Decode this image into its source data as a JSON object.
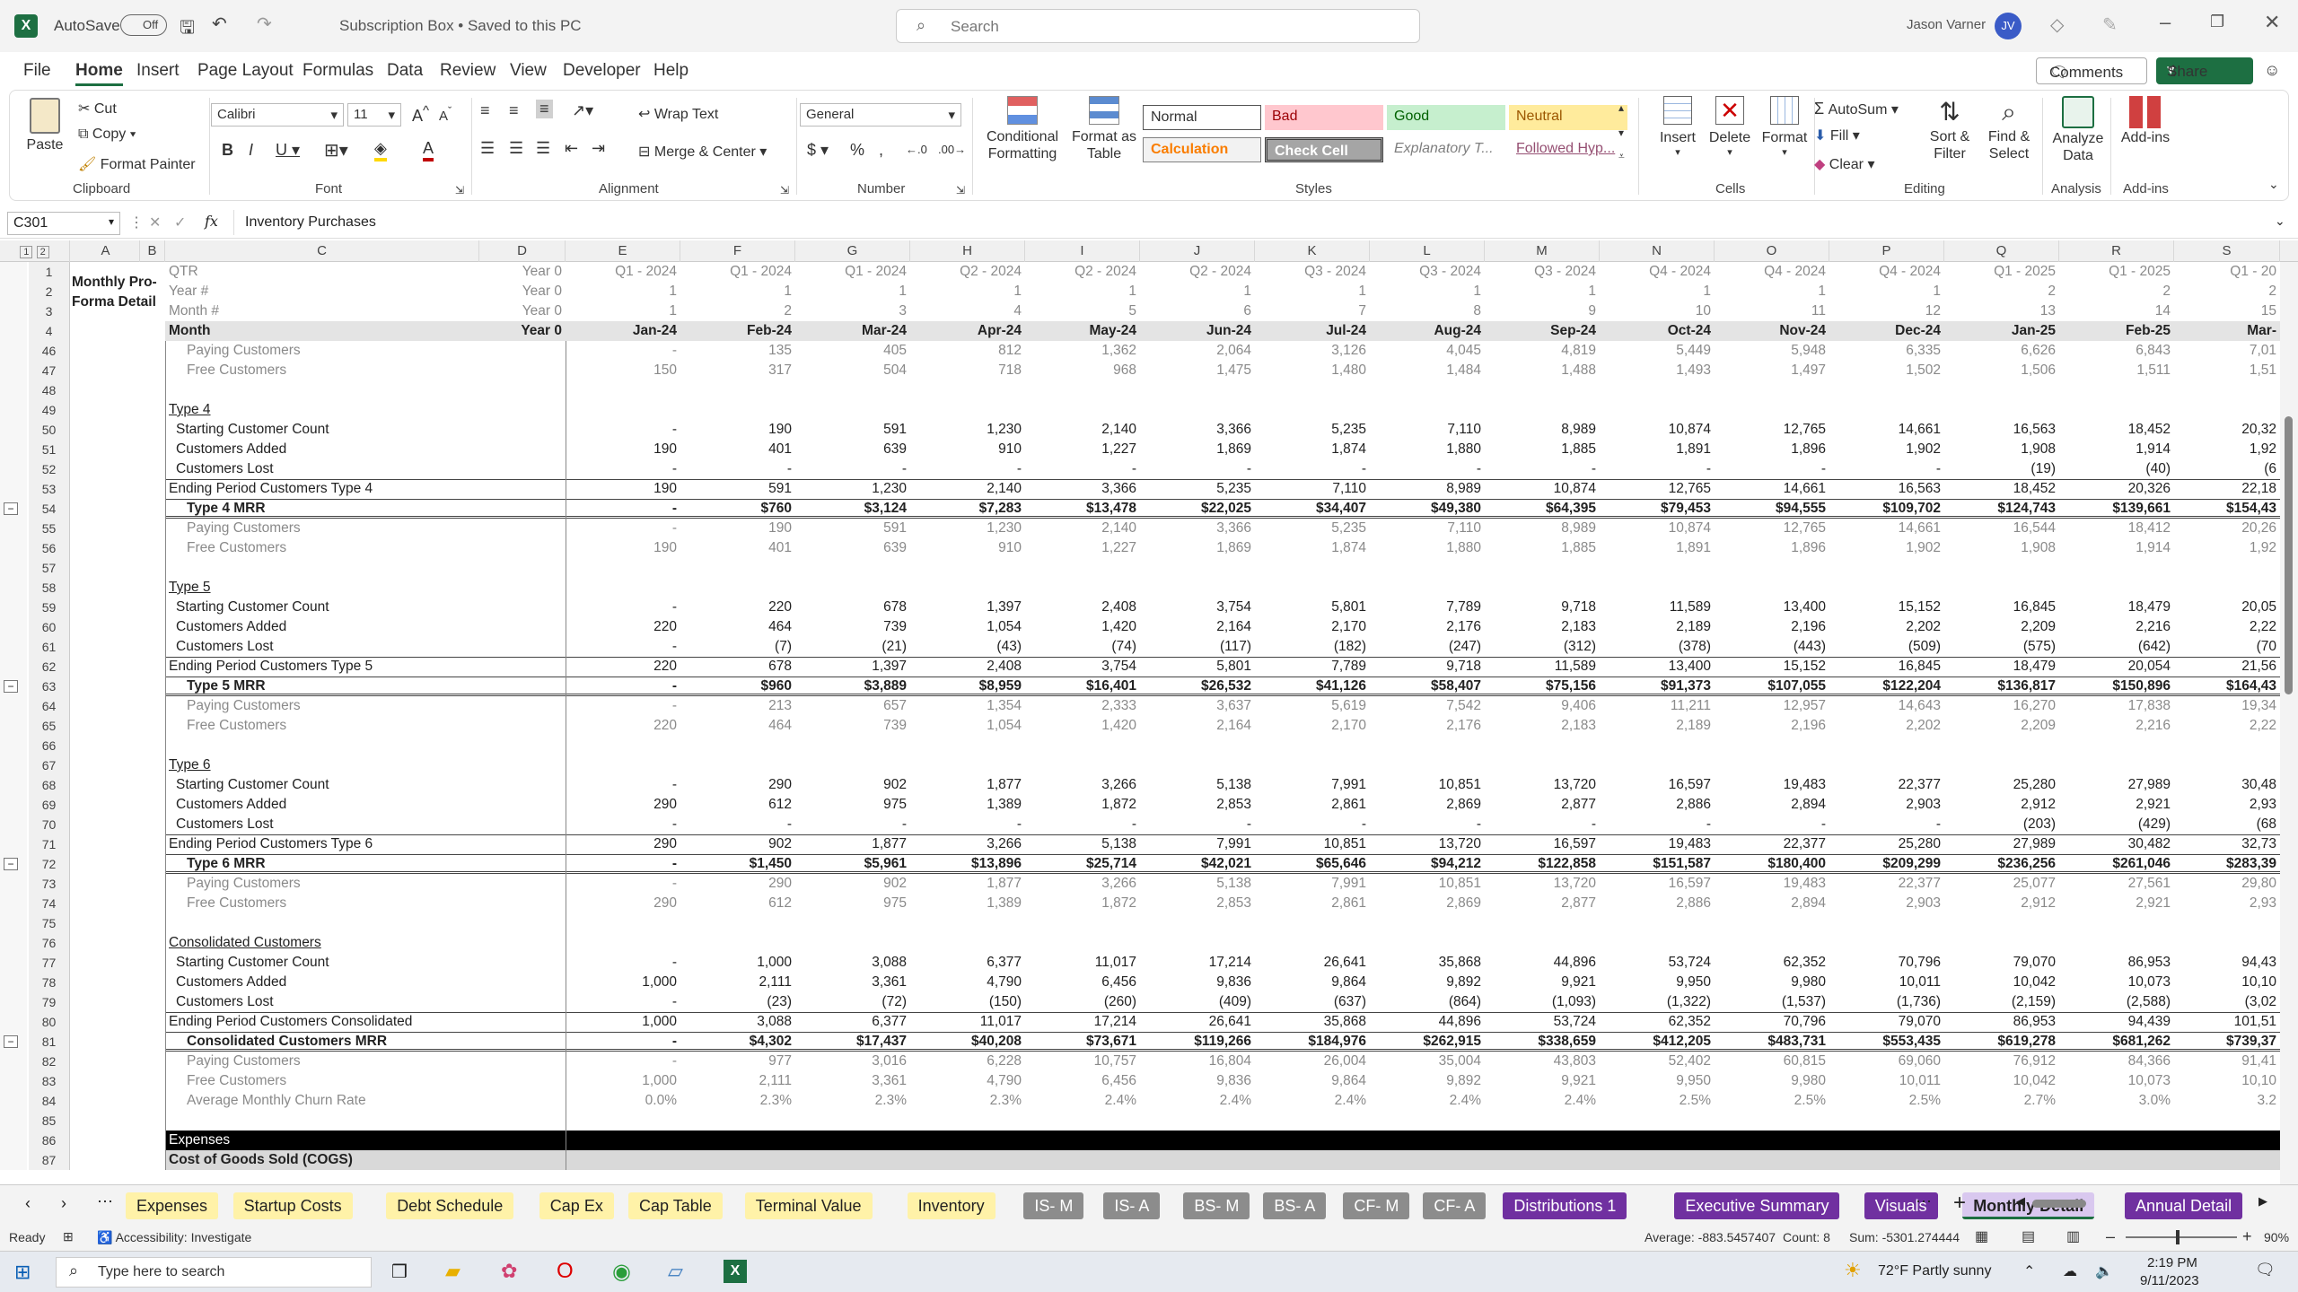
{
  "title": {
    "autosave": "AutoSave",
    "autosave_state": "Off",
    "doc": "Subscription Box • Saved to this PC",
    "search": "Search",
    "user": "Jason Varner",
    "initials": "JV"
  },
  "menu": [
    "File",
    "Home",
    "Insert",
    "Page Layout",
    "Formulas",
    "Data",
    "Review",
    "View",
    "Developer",
    "Help"
  ],
  "comments": "Comments",
  "share": "Share",
  "ribbon": {
    "paste": "Paste",
    "cut": "Cut",
    "copy": "Copy",
    "format_painter": "Format Painter",
    "clipboard": "Clipboard",
    "font_name": "Calibri",
    "font_size": "11",
    "font": "Font",
    "wrap": "Wrap Text",
    "merge": "Merge & Center",
    "alignment": "Alignment",
    "numfmt": "General",
    "number": "Number",
    "cond": "Conditional Formatting",
    "fmt_table": "Format as Table",
    "styles": [
      "Normal",
      "Bad",
      "Good",
      "Neutral",
      "Calculation",
      "Check Cell",
      "Explanatory T...",
      "Followed Hyp..."
    ],
    "styles_label": "Styles",
    "insert": "Insert",
    "delete": "Delete",
    "format": "Format",
    "cells": "Cells",
    "autosum": "AutoSum",
    "fill": "Fill",
    "clear": "Clear",
    "sort": "Sort & Filter",
    "find": "Find & Select",
    "editing": "Editing",
    "analyze": "Analyze Data",
    "analysis": "Analysis",
    "addins": "Add-ins",
    "addins_label": "Add-ins"
  },
  "formula": {
    "namebox": "C301",
    "content": "Inventory Purchases"
  },
  "columns": [
    "A",
    "B",
    "C",
    "D",
    "E",
    "F",
    "G",
    "H",
    "I",
    "J",
    "K",
    "L",
    "M",
    "N",
    "O",
    "P",
    "Q",
    "R",
    "S"
  ],
  "header_rows": [
    {
      "n": "1",
      "label": "QTR",
      "d": "Year 0",
      "vals": [
        "Q1 - 2024",
        "Q1 - 2024",
        "Q1 - 2024",
        "Q2 - 2024",
        "Q2 - 2024",
        "Q2 - 2024",
        "Q3 - 2024",
        "Q3 - 2024",
        "Q3 - 2024",
        "Q4 - 2024",
        "Q4 - 2024",
        "Q4 - 2024",
        "Q1 - 2025",
        "Q1 - 2025",
        "Q1 - 20"
      ]
    },
    {
      "n": "2",
      "label": "Year #",
      "d": "Year 0",
      "vals": [
        "1",
        "1",
        "1",
        "1",
        "1",
        "1",
        "1",
        "1",
        "1",
        "1",
        "1",
        "1",
        "2",
        "2",
        "2"
      ]
    },
    {
      "n": "3",
      "label": "Month #",
      "d": "Year 0",
      "vals": [
        "1",
        "2",
        "3",
        "4",
        "5",
        "6",
        "7",
        "8",
        "9",
        "10",
        "11",
        "12",
        "13",
        "14",
        "15"
      ]
    },
    {
      "n": "4",
      "label": "Month",
      "d": "Year 0",
      "vals": [
        "Jan-24",
        "Feb-24",
        "Mar-24",
        "Apr-24",
        "May-24",
        "Jun-24",
        "Jul-24",
        "Aug-24",
        "Sep-24",
        "Oct-24",
        "Nov-24",
        "Dec-24",
        "Jan-25",
        "Feb-25",
        "Mar-"
      ]
    }
  ],
  "sheet_title": "Monthly Pro-Forma Detail",
  "rows": [
    {
      "n": "46",
      "label": "Paying Customers",
      "s": "grey",
      "vals": [
        "-",
        "135",
        "405",
        "812",
        "1,362",
        "2,064",
        "3,126",
        "4,045",
        "4,819",
        "5,449",
        "5,948",
        "6,335",
        "6,626",
        "6,843",
        "7,01"
      ]
    },
    {
      "n": "47",
      "label": "Free Customers",
      "s": "grey",
      "vals": [
        "150",
        "317",
        "504",
        "718",
        "968",
        "1,475",
        "1,480",
        "1,484",
        "1,488",
        "1,493",
        "1,497",
        "1,502",
        "1,506",
        "1,511",
        "1,51"
      ]
    },
    {
      "n": "48",
      "label": "",
      "vals": []
    },
    {
      "n": "49",
      "label": "Type 4",
      "s": "u",
      "vals": []
    },
    {
      "n": "50",
      "label": "Starting Customer Count",
      "vals": [
        "-",
        "190",
        "591",
        "1,230",
        "2,140",
        "3,366",
        "5,235",
        "7,110",
        "8,989",
        "10,874",
        "12,765",
        "14,661",
        "16,563",
        "18,452",
        "20,32"
      ]
    },
    {
      "n": "51",
      "label": "Customers Added",
      "vals": [
        "190",
        "401",
        "639",
        "910",
        "1,227",
        "1,869",
        "1,874",
        "1,880",
        "1,885",
        "1,891",
        "1,896",
        "1,902",
        "1,908",
        "1,914",
        "1,92"
      ]
    },
    {
      "n": "52",
      "label": "Customers Lost",
      "vals": [
        "-",
        "-",
        "-",
        "-",
        "-",
        "-",
        "-",
        "-",
        "-",
        "-",
        "-",
        "-",
        "(19)",
        "(40)",
        "(6"
      ]
    },
    {
      "n": "53",
      "label": "Ending Period Customers Type 4",
      "s": "end",
      "vals": [
        "190",
        "591",
        "1,230",
        "2,140",
        "3,366",
        "5,235",
        "7,110",
        "8,989",
        "10,874",
        "12,765",
        "14,661",
        "16,563",
        "18,452",
        "20,326",
        "22,18"
      ]
    },
    {
      "n": "54",
      "label": "Type 4 MRR",
      "s": "mrr",
      "vals": [
        "-",
        "$760",
        "$3,124",
        "$7,283",
        "$13,478",
        "$22,025",
        "$34,407",
        "$49,380",
        "$64,395",
        "$79,453",
        "$94,555",
        "$109,702",
        "$124,743",
        "$139,661",
        "$154,43"
      ]
    },
    {
      "n": "55",
      "label": "Paying Customers",
      "s": "grey",
      "vals": [
        "-",
        "190",
        "591",
        "1,230",
        "2,140",
        "3,366",
        "5,235",
        "7,110",
        "8,989",
        "10,874",
        "12,765",
        "14,661",
        "16,544",
        "18,412",
        "20,26"
      ]
    },
    {
      "n": "56",
      "label": "Free Customers",
      "s": "grey",
      "vals": [
        "190",
        "401",
        "639",
        "910",
        "1,227",
        "1,869",
        "1,874",
        "1,880",
        "1,885",
        "1,891",
        "1,896",
        "1,902",
        "1,908",
        "1,914",
        "1,92"
      ]
    },
    {
      "n": "57",
      "label": "",
      "vals": []
    },
    {
      "n": "58",
      "label": "Type 5",
      "s": "u",
      "vals": []
    },
    {
      "n": "59",
      "label": "Starting Customer Count",
      "vals": [
        "-",
        "220",
        "678",
        "1,397",
        "2,408",
        "3,754",
        "5,801",
        "7,789",
        "9,718",
        "11,589",
        "13,400",
        "15,152",
        "16,845",
        "18,479",
        "20,05"
      ]
    },
    {
      "n": "60",
      "label": "Customers Added",
      "vals": [
        "220",
        "464",
        "739",
        "1,054",
        "1,420",
        "2,164",
        "2,170",
        "2,176",
        "2,183",
        "2,189",
        "2,196",
        "2,202",
        "2,209",
        "2,216",
        "2,22"
      ]
    },
    {
      "n": "61",
      "label": "Customers Lost",
      "vals": [
        "-",
        "(7)",
        "(21)",
        "(43)",
        "(74)",
        "(117)",
        "(182)",
        "(247)",
        "(312)",
        "(378)",
        "(443)",
        "(509)",
        "(575)",
        "(642)",
        "(70"
      ]
    },
    {
      "n": "62",
      "label": "Ending Period Customers Type 5",
      "s": "end",
      "vals": [
        "220",
        "678",
        "1,397",
        "2,408",
        "3,754",
        "5,801",
        "7,789",
        "9,718",
        "11,589",
        "13,400",
        "15,152",
        "16,845",
        "18,479",
        "20,054",
        "21,56"
      ]
    },
    {
      "n": "63",
      "label": "Type 5 MRR",
      "s": "mrr",
      "vals": [
        "-",
        "$960",
        "$3,889",
        "$8,959",
        "$16,401",
        "$26,532",
        "$41,126",
        "$58,407",
        "$75,156",
        "$91,373",
        "$107,055",
        "$122,204",
        "$136,817",
        "$150,896",
        "$164,43"
      ]
    },
    {
      "n": "64",
      "label": "Paying Customers",
      "s": "grey",
      "vals": [
        "-",
        "213",
        "657",
        "1,354",
        "2,333",
        "3,637",
        "5,619",
        "7,542",
        "9,406",
        "11,211",
        "12,957",
        "14,643",
        "16,270",
        "17,838",
        "19,34"
      ]
    },
    {
      "n": "65",
      "label": "Free Customers",
      "s": "grey",
      "vals": [
        "220",
        "464",
        "739",
        "1,054",
        "1,420",
        "2,164",
        "2,170",
        "2,176",
        "2,183",
        "2,189",
        "2,196",
        "2,202",
        "2,209",
        "2,216",
        "2,22"
      ]
    },
    {
      "n": "66",
      "label": "",
      "vals": []
    },
    {
      "n": "67",
      "label": "Type 6",
      "s": "u",
      "vals": []
    },
    {
      "n": "68",
      "label": "Starting Customer Count",
      "vals": [
        "-",
        "290",
        "902",
        "1,877",
        "3,266",
        "5,138",
        "7,991",
        "10,851",
        "13,720",
        "16,597",
        "19,483",
        "22,377",
        "25,280",
        "27,989",
        "30,48"
      ]
    },
    {
      "n": "69",
      "label": "Customers Added",
      "vals": [
        "290",
        "612",
        "975",
        "1,389",
        "1,872",
        "2,853",
        "2,861",
        "2,869",
        "2,877",
        "2,886",
        "2,894",
        "2,903",
        "2,912",
        "2,921",
        "2,93"
      ]
    },
    {
      "n": "70",
      "label": "Customers Lost",
      "vals": [
        "-",
        "-",
        "-",
        "-",
        "-",
        "-",
        "-",
        "-",
        "-",
        "-",
        "-",
        "-",
        "(203)",
        "(429)",
        "(68"
      ]
    },
    {
      "n": "71",
      "label": "Ending Period Customers Type 6",
      "s": "end",
      "vals": [
        "290",
        "902",
        "1,877",
        "3,266",
        "5,138",
        "7,991",
        "10,851",
        "13,720",
        "16,597",
        "19,483",
        "22,377",
        "25,280",
        "27,989",
        "30,482",
        "32,73"
      ]
    },
    {
      "n": "72",
      "label": "Type 6 MRR",
      "s": "mrr",
      "vals": [
        "-",
        "$1,450",
        "$5,961",
        "$13,896",
        "$25,714",
        "$42,021",
        "$65,646",
        "$94,212",
        "$122,858",
        "$151,587",
        "$180,400",
        "$209,299",
        "$236,256",
        "$261,046",
        "$283,39"
      ]
    },
    {
      "n": "73",
      "label": "Paying Customers",
      "s": "grey",
      "vals": [
        "-",
        "290",
        "902",
        "1,877",
        "3,266",
        "5,138",
        "7,991",
        "10,851",
        "13,720",
        "16,597",
        "19,483",
        "22,377",
        "25,077",
        "27,561",
        "29,80"
      ]
    },
    {
      "n": "74",
      "label": "Free Customers",
      "s": "grey",
      "vals": [
        "290",
        "612",
        "975",
        "1,389",
        "1,872",
        "2,853",
        "2,861",
        "2,869",
        "2,877",
        "2,886",
        "2,894",
        "2,903",
        "2,912",
        "2,921",
        "2,93"
      ]
    },
    {
      "n": "75",
      "label": "",
      "vals": []
    },
    {
      "n": "76",
      "label": "Consolidated Customers",
      "s": "u",
      "vals": []
    },
    {
      "n": "77",
      "label": "Starting Customer Count",
      "vals": [
        "-",
        "1,000",
        "3,088",
        "6,377",
        "11,017",
        "17,214",
        "26,641",
        "35,868",
        "44,896",
        "53,724",
        "62,352",
        "70,796",
        "79,070",
        "86,953",
        "94,43"
      ]
    },
    {
      "n": "78",
      "label": "Customers Added",
      "vals": [
        "1,000",
        "2,111",
        "3,361",
        "4,790",
        "6,456",
        "9,836",
        "9,864",
        "9,892",
        "9,921",
        "9,950",
        "9,980",
        "10,011",
        "10,042",
        "10,073",
        "10,10"
      ]
    },
    {
      "n": "79",
      "label": "Customers Lost",
      "vals": [
        "-",
        "(23)",
        "(72)",
        "(150)",
        "(260)",
        "(409)",
        "(637)",
        "(864)",
        "(1,093)",
        "(1,322)",
        "(1,537)",
        "(1,736)",
        "(2,159)",
        "(2,588)",
        "(3,02"
      ]
    },
    {
      "n": "80",
      "label": "Ending Period Customers Consolidated",
      "s": "end",
      "vals": [
        "1,000",
        "3,088",
        "6,377",
        "11,017",
        "17,214",
        "26,641",
        "35,868",
        "44,896",
        "53,724",
        "62,352",
        "70,796",
        "79,070",
        "86,953",
        "94,439",
        "101,51"
      ]
    },
    {
      "n": "81",
      "label": "Consolidated Customers MRR",
      "s": "mrr",
      "vals": [
        "-",
        "$4,302",
        "$17,437",
        "$40,208",
        "$73,671",
        "$119,266",
        "$184,976",
        "$262,915",
        "$338,659",
        "$412,205",
        "$483,731",
        "$553,435",
        "$619,278",
        "$681,262",
        "$739,37"
      ]
    },
    {
      "n": "82",
      "label": "Paying Customers",
      "s": "grey",
      "vals": [
        "-",
        "977",
        "3,016",
        "6,228",
        "10,757",
        "16,804",
        "26,004",
        "35,004",
        "43,803",
        "52,402",
        "60,815",
        "69,060",
        "76,912",
        "84,366",
        "91,41"
      ]
    },
    {
      "n": "83",
      "label": "Free Customers",
      "s": "grey",
      "vals": [
        "1,000",
        "2,111",
        "3,361",
        "4,790",
        "6,456",
        "9,836",
        "9,864",
        "9,892",
        "9,921",
        "9,950",
        "9,980",
        "10,011",
        "10,042",
        "10,073",
        "10,10"
      ]
    },
    {
      "n": "84",
      "label": "Average Monthly Churn Rate",
      "s": "grey",
      "vals": [
        "0.0%",
        "2.3%",
        "2.3%",
        "2.3%",
        "2.4%",
        "2.4%",
        "2.4%",
        "2.4%",
        "2.4%",
        "2.5%",
        "2.5%",
        "2.5%",
        "2.7%",
        "3.0%",
        "3.2"
      ]
    },
    {
      "n": "85",
      "label": "",
      "vals": []
    },
    {
      "n": "86",
      "label": "Expenses",
      "s": "black",
      "vals": []
    },
    {
      "n": "87",
      "label": "Cost of Goods Sold (COGS)",
      "s": "cogs",
      "vals": []
    }
  ],
  "sheet_tabs": [
    {
      "name": "Expenses",
      "color": "#fff2a8"
    },
    {
      "name": "Startup Costs",
      "color": "#fff2a8"
    },
    {
      "name": "Debt Schedule",
      "color": "#fff2a8"
    },
    {
      "name": "Cap Ex",
      "color": "#fff2a8"
    },
    {
      "name": "Cap Table",
      "color": "#fff2a8"
    },
    {
      "name": "Terminal Value",
      "color": "#fff2a8"
    },
    {
      "name": "Inventory",
      "color": "#fff2a8"
    },
    {
      "name": "IS- M",
      "color": "#8c8c8c"
    },
    {
      "name": "IS- A",
      "color": "#8c8c8c"
    },
    {
      "name": "BS- M",
      "color": "#8c8c8c"
    },
    {
      "name": "BS- A",
      "color": "#8c8c8c"
    },
    {
      "name": "CF- M",
      "color": "#8c8c8c"
    },
    {
      "name": "CF- A",
      "color": "#8c8c8c"
    },
    {
      "name": "Distributions 1",
      "color": "#7030a0"
    },
    {
      "name": "Executive Summary",
      "color": "#7030a0"
    },
    {
      "name": "Visuals",
      "color": "#7030a0"
    },
    {
      "name": "Monthly Detail",
      "color": "#d9c8ef"
    },
    {
      "name": "Annual Detail",
      "color": "#7030a0"
    }
  ],
  "status": {
    "ready": "Ready",
    "accessibility": "Accessibility: Investigate",
    "average": "Average: -883.5457407",
    "count": "Count: 8",
    "sum": "Sum: -5301.274444",
    "zoom": "90%"
  },
  "taskbar": {
    "search": "Type here to search",
    "weather": "72°F  Partly sunny",
    "time": "2:19 PM",
    "date": "9/11/2023"
  }
}
